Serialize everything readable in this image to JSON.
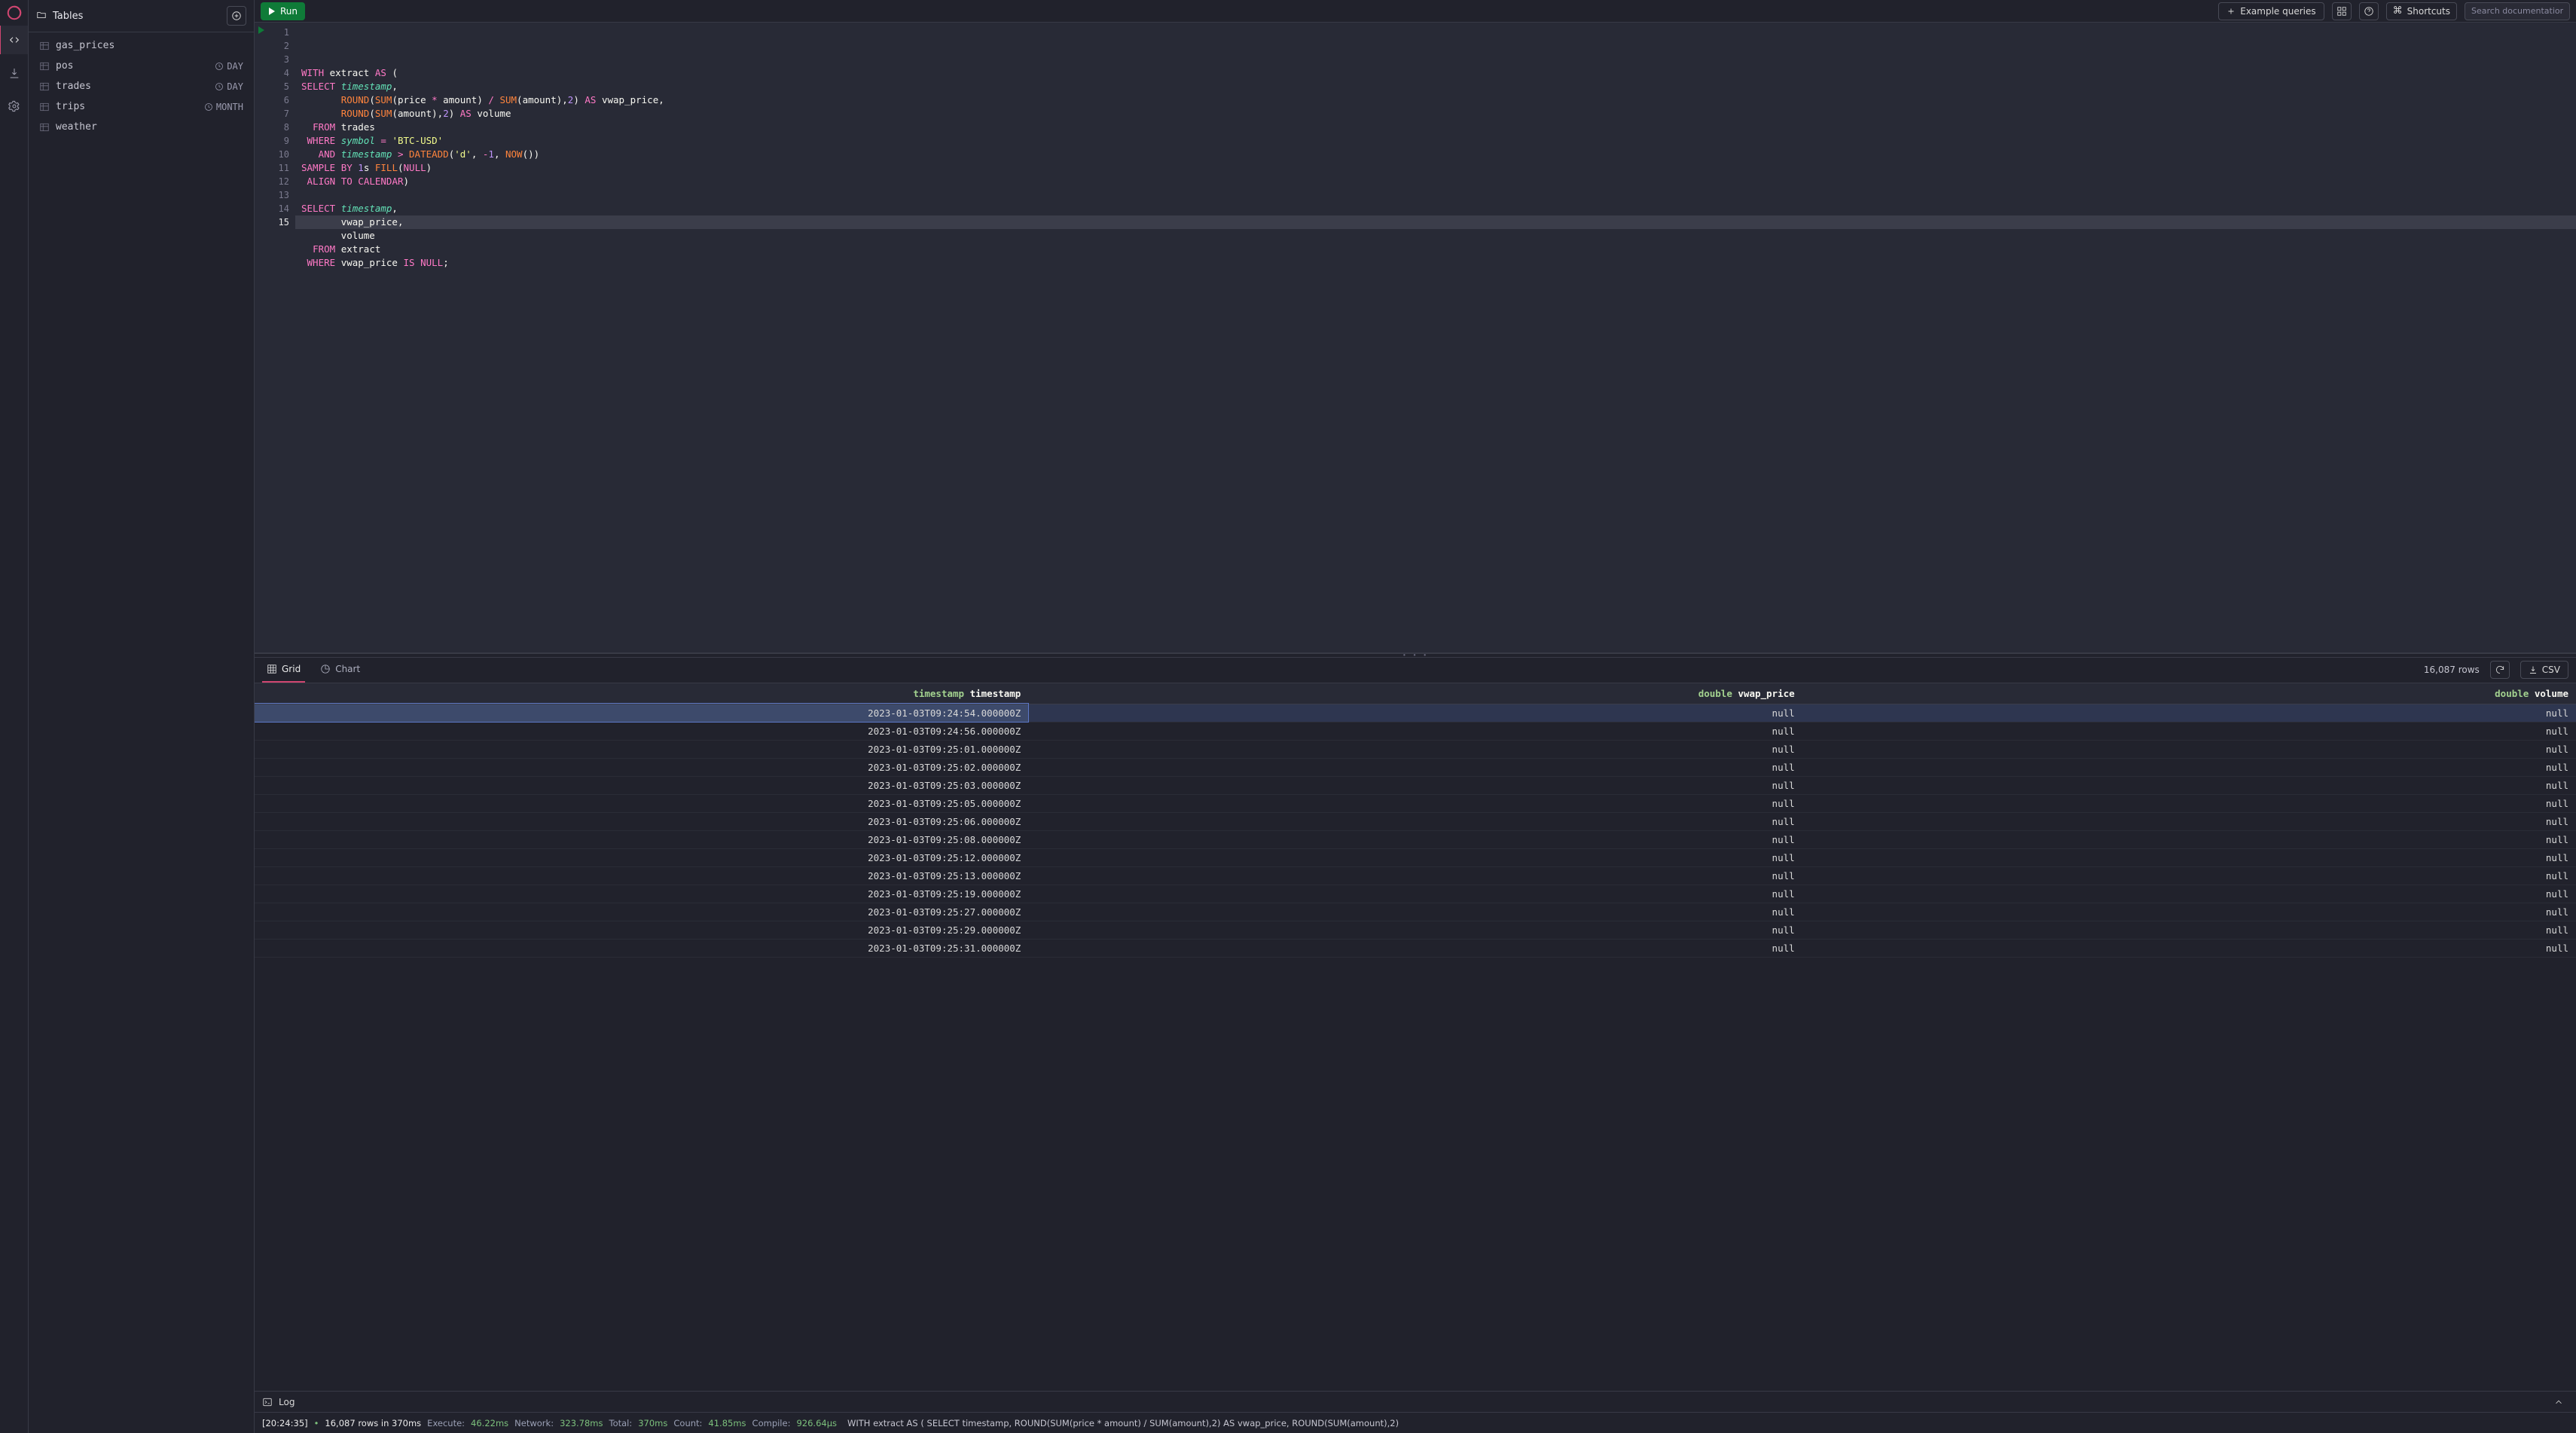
{
  "brand_color": "#d14671",
  "sidebar": {
    "title": "Tables",
    "items": [
      {
        "name": "gas_prices",
        "age": ""
      },
      {
        "name": "pos",
        "age": "DAY"
      },
      {
        "name": "trades",
        "age": "DAY"
      },
      {
        "name": "trips",
        "age": "MONTH"
      },
      {
        "name": "weather",
        "age": ""
      }
    ]
  },
  "toolbar": {
    "run_label": "Run",
    "example_label": "Example queries",
    "shortcuts_label": "Shortcuts",
    "search_placeholder": "Search documentation"
  },
  "editor": {
    "total_lines": 15,
    "current_line": 15,
    "html": "<span class=\"kw\">WITH</span> extract <span class=\"kw\">AS</span> <span class=\"pl\">(</span>\n<span class=\"kw\">SELECT</span> <span class=\"id\">timestamp</span><span class=\"pl\">,</span>\n       <span class=\"fn\">ROUND</span><span class=\"pl\">(</span><span class=\"fn\">SUM</span><span class=\"pl\">(</span>price <span class=\"op\">*</span> amount<span class=\"pl\">)</span> <span class=\"op\">/</span> <span class=\"fn\">SUM</span><span class=\"pl\">(</span>amount<span class=\"pl\">),</span><span class=\"num\">2</span><span class=\"pl\">)</span> <span class=\"kw\">AS</span> vwap_price<span class=\"pl\">,</span>\n       <span class=\"fn\">ROUND</span><span class=\"pl\">(</span><span class=\"fn\">SUM</span><span class=\"pl\">(</span>amount<span class=\"pl\">),</span><span class=\"num\">2</span><span class=\"pl\">)</span> <span class=\"kw\">AS</span> volume\n  <span class=\"kw\">FROM</span> trades\n <span class=\"kw\">WHERE</span> <span class=\"id\">symbol</span> <span class=\"op\">=</span> <span class=\"str\">'BTC-USD'</span>\n   <span class=\"kw\">AND</span> <span class=\"id\">timestamp</span> <span class=\"op\">&gt;</span> <span class=\"fn\">DATEADD</span><span class=\"pl\">(</span><span class=\"str\">'d'</span><span class=\"pl\">,</span> <span class=\"op\">-</span><span class=\"num\">1</span><span class=\"pl\">,</span> <span class=\"fn\">NOW</span><span class=\"pl\">())</span>\n<span class=\"kw\">SAMPLE</span> <span class=\"kw\">BY</span> <span class=\"num\">1</span>s <span class=\"fn\">FILL</span><span class=\"pl\">(</span><span class=\"kw\">NULL</span><span class=\"pl\">)</span>\n <span class=\"kw\">ALIGN</span> <span class=\"kw\">TO</span> <span class=\"kw\">CALENDAR</span><span class=\"pl\">)</span>\n\n<span class=\"kw\">SELECT</span> <span class=\"id\">timestamp</span><span class=\"pl\">,</span>\n       vwap_price<span class=\"pl\">,</span>\n       volume\n  <span class=\"kw\">FROM</span> extract\n <span class=\"kw\">WHERE</span> vwap_price <span class=\"kw\">IS</span> <span class=\"kw\">NULL</span><span class=\"pl\">;</span>"
  },
  "results": {
    "tabs": {
      "grid": "Grid",
      "chart": "Chart"
    },
    "row_count_label": "16,087 rows",
    "csv_label": "CSV",
    "columns": [
      {
        "type": "timestamp",
        "name": "timestamp"
      },
      {
        "type": "double",
        "name": "vwap_price"
      },
      {
        "type": "double",
        "name": "volume"
      }
    ],
    "rows": [
      [
        "2023-01-03T09:24:54.000000Z",
        "null",
        "null"
      ],
      [
        "2023-01-03T09:24:56.000000Z",
        "null",
        "null"
      ],
      [
        "2023-01-03T09:25:01.000000Z",
        "null",
        "null"
      ],
      [
        "2023-01-03T09:25:02.000000Z",
        "null",
        "null"
      ],
      [
        "2023-01-03T09:25:03.000000Z",
        "null",
        "null"
      ],
      [
        "2023-01-03T09:25:05.000000Z",
        "null",
        "null"
      ],
      [
        "2023-01-03T09:25:06.000000Z",
        "null",
        "null"
      ],
      [
        "2023-01-03T09:25:08.000000Z",
        "null",
        "null"
      ],
      [
        "2023-01-03T09:25:12.000000Z",
        "null",
        "null"
      ],
      [
        "2023-01-03T09:25:13.000000Z",
        "null",
        "null"
      ],
      [
        "2023-01-03T09:25:19.000000Z",
        "null",
        "null"
      ],
      [
        "2023-01-03T09:25:27.000000Z",
        "null",
        "null"
      ],
      [
        "2023-01-03T09:25:29.000000Z",
        "null",
        "null"
      ],
      [
        "2023-01-03T09:25:31.000000Z",
        "null",
        "null"
      ]
    ],
    "selected_row_index": 0
  },
  "log": {
    "label": "Log"
  },
  "status": {
    "time_tag": "[20:24:35]",
    "rows_msg": "16,087 rows in 370ms",
    "exec_label": "Execute:",
    "exec_val": "46.22ms",
    "net_label": "Network:",
    "net_val": "323.78ms",
    "total_label": "Total:",
    "total_val": "370ms",
    "count_label": "Count:",
    "count_val": "41.85ms",
    "compile_label": "Compile:",
    "compile_val": "926.64µs",
    "sql_preview": "WITH extract AS ( SELECT timestamp, ROUND(SUM(price * amount) / SUM(amount),2) AS vwap_price, ROUND(SUM(amount),2)"
  }
}
